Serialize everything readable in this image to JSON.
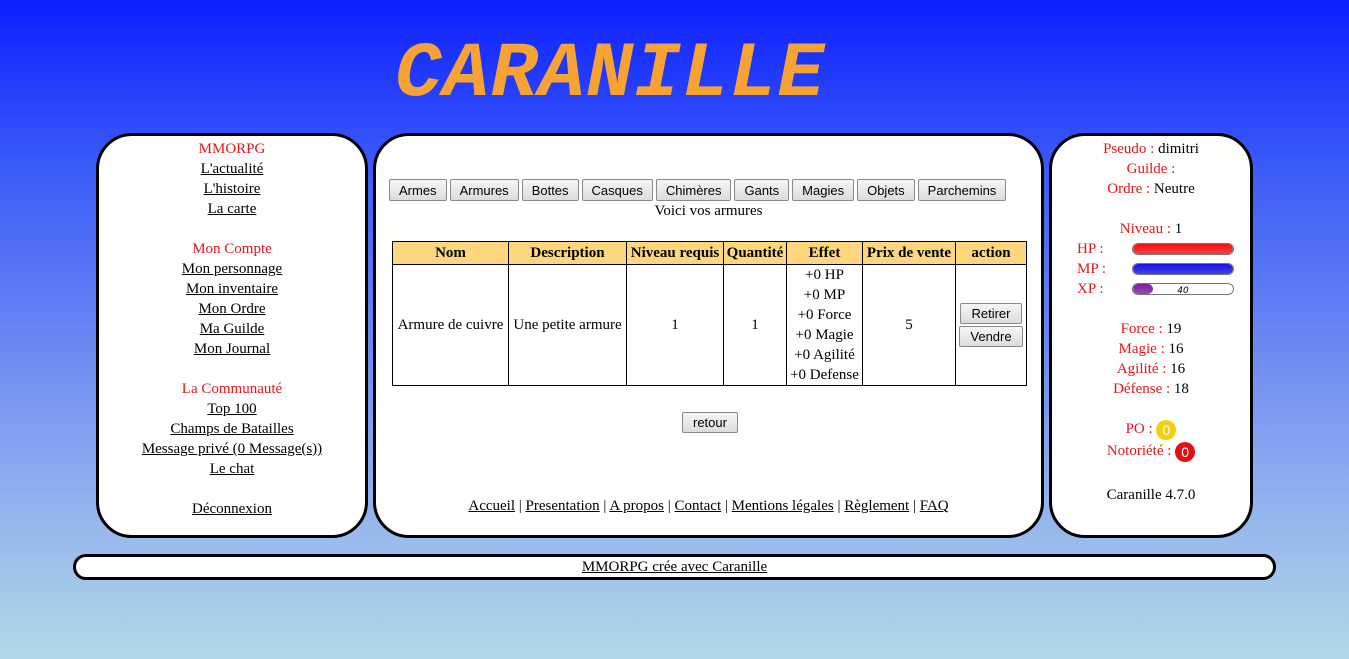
{
  "logo": "CARANILLE",
  "left_menu": {
    "section1_title": "MMORPG",
    "section1_links": [
      "L'actualité",
      "L'histoire",
      "La carte"
    ],
    "section2_title": "Mon Compte",
    "section2_links": [
      "Mon personnage",
      "Mon inventaire",
      "Mon Ordre",
      "Ma Guilde",
      "Mon Journal"
    ],
    "section3_title": "La Communauté",
    "section3_links": [
      "Top 100",
      "Champs de Batailles",
      "Message privé (0 Message(s))",
      "Le chat"
    ],
    "logout": "Déconnexion"
  },
  "tabs": [
    "Armes",
    "Armures",
    "Bottes",
    "Casques",
    "Chimères",
    "Gants",
    "Magies",
    "Objets",
    "Parchemins"
  ],
  "subtitle": "Voici vos armures",
  "table": {
    "headers": [
      "Nom",
      "Description",
      "Niveau requis",
      "Quantité",
      "Effet",
      "Prix de vente",
      "action"
    ],
    "row": {
      "nom": "Armure de cuivre",
      "description": "Une petite armure",
      "niveau": "1",
      "quantite": "1",
      "effets": [
        "+0 HP",
        "+0 MP",
        "+0 Force",
        "+0 Magie",
        "+0 Agilité",
        "+0 Defense"
      ],
      "prix": "5",
      "retirer": "Retirer",
      "vendre": "Vendre"
    }
  },
  "retour": "retour",
  "footer_links": [
    "Accueil",
    "Presentation",
    "A propos",
    "Contact",
    "Mentions légales",
    "Règlement",
    "FAQ"
  ],
  "stats": {
    "pseudo_label": "Pseudo :",
    "pseudo": "dimitri",
    "guilde_label": "Guilde :",
    "guilde": "",
    "ordre_label": "Ordre :",
    "ordre": "Neutre",
    "niveau_label": "Niveau :",
    "niveau": "1",
    "hp_label": "HP :",
    "hp_fraction": 1.0,
    "hp_color": "#f01010",
    "mp_label": "MP :",
    "mp_fraction": 1.0,
    "mp_color": "#1414e0",
    "xp_label": "XP :",
    "xp_fraction": 0.2,
    "xp_value": "40",
    "xp_color": "#7a1ea0",
    "force_label": "Force :",
    "force": "19",
    "magie_label": "Magie :",
    "magie": "16",
    "agilite_label": "Agilité :",
    "agilite": "16",
    "defense_label": "Défense :",
    "defense": "18",
    "po_label": "PO :",
    "po": "0",
    "po_color": "#f2d010",
    "notoriete_label": "Notoriété :",
    "notoriete": "0",
    "notoriete_color": "#e01010",
    "version": "Caranille 4.7.0"
  },
  "footer": "MMORPG crée avec Caranille"
}
